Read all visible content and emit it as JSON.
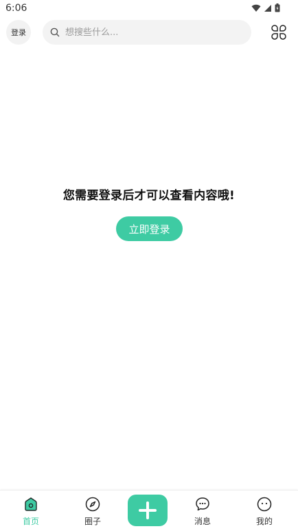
{
  "status_bar": {
    "time": "6:06"
  },
  "header": {
    "login_label": "登录",
    "search_placeholder": "想搜些什么..."
  },
  "empty_state": {
    "message": "您需要登录后才可以查看内容哦!",
    "login_button": "立即登录"
  },
  "bottom_nav": {
    "items": [
      {
        "label": "首页",
        "icon": "home-icon",
        "active": true
      },
      {
        "label": "圈子",
        "icon": "compass-icon",
        "active": false
      },
      {
        "label": "消息",
        "icon": "chat-icon",
        "active": false
      },
      {
        "label": "我的",
        "icon": "profile-face-icon",
        "active": false
      }
    ],
    "add_icon": "plus-icon"
  },
  "colors": {
    "accent": "#3ecba3",
    "chip_bg": "#f2f2f2"
  }
}
